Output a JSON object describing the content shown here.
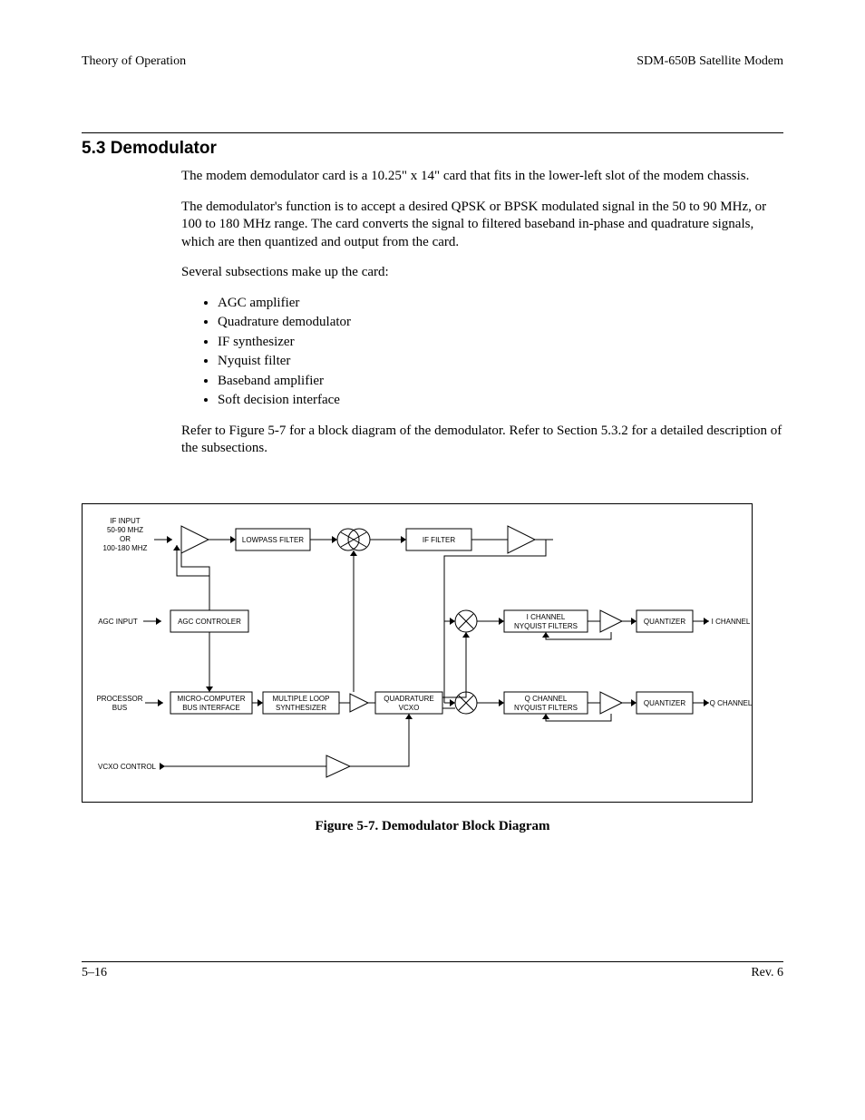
{
  "header": {
    "left": "Theory of Operation",
    "right": "SDM-650B Satellite Modem"
  },
  "section": {
    "number_title": "5.3  Demodulator",
    "para1": "The modem demodulator card is a 10.25\" x 14\" card that fits in the lower-left slot of the modem chassis.",
    "para2": "The demodulator's function is to accept a desired QPSK or BPSK modulated signal in the 50 to 90 MHz, or 100 to 180 MHz range. The card converts the signal to filtered baseband in-phase and quadrature signals, which are then quantized and output from the card.",
    "para3": "Several subsections make up the card:",
    "bullets": [
      "AGC amplifier",
      "Quadrature demodulator",
      "IF synthesizer",
      "Nyquist filter",
      "Baseband amplifier",
      "Soft decision interface"
    ],
    "para4": "Refer to Figure 5-7 for a block diagram of the demodulator. Refer to Section 5.3.2 for a detailed description of the subsections."
  },
  "figure": {
    "caption": "Figure 5-7.  Demodulator Block Diagram",
    "labels": {
      "if_input_l1": "IF INPUT",
      "if_input_l2": "50-90 MHZ",
      "if_input_l3": "OR",
      "if_input_l4": "100-180 MHZ",
      "lowpass": "LOWPASS FILTER",
      "if_filter": "IF FILTER",
      "agc_input": "AGC INPUT",
      "agc_controler": "AGC CONTROLER",
      "i_nyquist_l1": "I CHANNEL",
      "i_nyquist_l2": "NYQUIST FILTERS",
      "quantizer": "QUANTIZER",
      "i_channel_out": "I CHANNEL",
      "processor_l1": "PROCESSOR",
      "processor_l2": "BUS",
      "micro_l1": "MICRO-COMPUTER",
      "micro_l2": "BUS INTERFACE",
      "mloop_l1": "MULTIPLE LOOP",
      "mloop_l2": "SYNTHESIZER",
      "quad_l1": "QUADRATURE",
      "quad_l2": "VCXO",
      "q_nyquist_l1": "Q CHANNEL",
      "q_nyquist_l2": "NYQUIST FILTERS",
      "q_channel_out": "Q CHANNEL",
      "vcxo_control": "VCXO CONTROL"
    }
  },
  "footer": {
    "left": "5–16",
    "right": "Rev. 6"
  }
}
